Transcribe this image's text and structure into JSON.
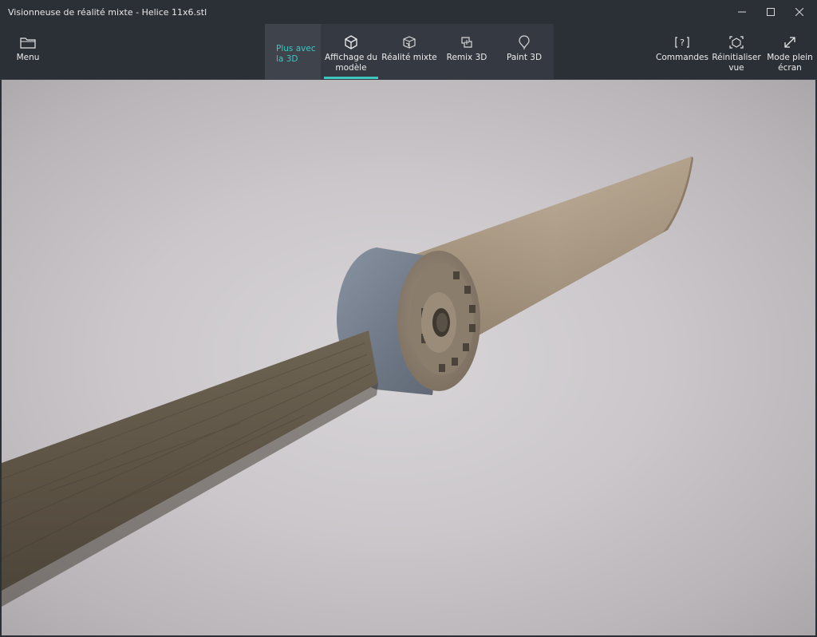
{
  "window": {
    "title": "Visionneuse de réalité mixte - Helice 11x6.stl"
  },
  "toolbar": {
    "menu_label": "Menu",
    "more3d_label": "Plus avec\nla 3D",
    "tabs": [
      {
        "label": "Affichage du\nmodèle",
        "icon": "cube-icon",
        "active": true
      },
      {
        "label": "Réalité mixte",
        "icon": "mixed-reality-icon",
        "active": false
      },
      {
        "label": "Remix 3D",
        "icon": "remix-icon",
        "active": false
      },
      {
        "label": "Paint 3D",
        "icon": "paint-icon",
        "active": false
      }
    ],
    "right": [
      {
        "label": "Commandes",
        "icon": "commands-icon"
      },
      {
        "label": "Réinitialiser\nvue",
        "icon": "reset-view-icon"
      },
      {
        "label": "Mode plein\nécran",
        "icon": "fullscreen-icon"
      }
    ]
  },
  "colors": {
    "chrome": "#2b2f36",
    "accent": "#3ec7c0",
    "hub": "#7c8796",
    "blade_light": "#b3a18c",
    "blade_dark": "#5f5648"
  },
  "viewport": {
    "model": "Helice 11x6.stl"
  }
}
